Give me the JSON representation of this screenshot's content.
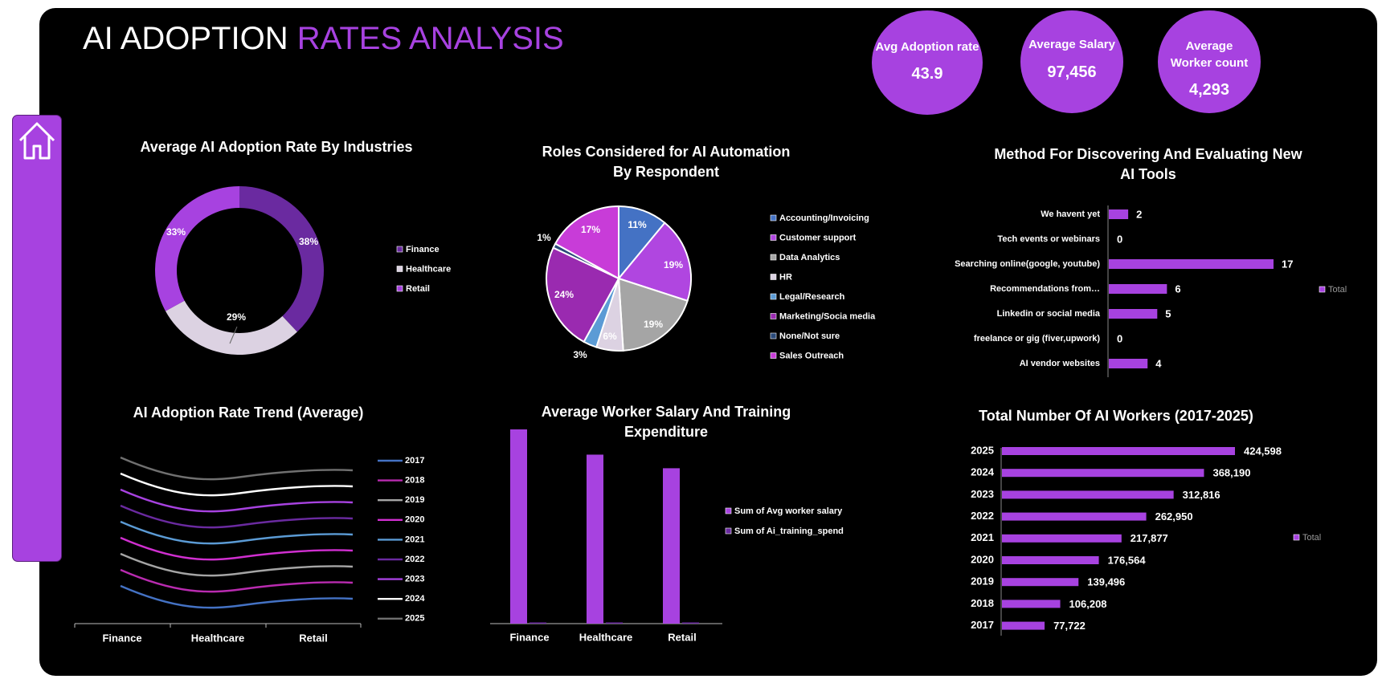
{
  "header": {
    "title_part1": "AI ADOPTION",
    "title_part2": "RATES ANALYSIS"
  },
  "kpis": [
    {
      "label": "Avg Adoption rate",
      "value": "43.9"
    },
    {
      "label": "Average Salary",
      "value": "97,456"
    },
    {
      "label": "Average Worker count",
      "value": "4,293"
    }
  ],
  "icons": {
    "home": "home-icon"
  },
  "colors": {
    "accent": "#a742e0",
    "background": "#000000"
  },
  "chart_data": [
    {
      "id": "industry-donut",
      "type": "pie",
      "title": "Average AI Adoption Rate By Industries",
      "labels": [
        "Finance",
        "Healthcare",
        "Retail"
      ],
      "values": [
        38,
        29,
        33
      ],
      "data_labels": [
        "38%",
        "29%",
        "33%"
      ],
      "colors": [
        "#6a2aa0",
        "#dcd2e2",
        "#a742e0"
      ],
      "legend": "right"
    },
    {
      "id": "roles-pie",
      "type": "pie",
      "title": "Roles Considered for AI Automation By Respondent",
      "labels": [
        "Accounting/Invoicing",
        "Customer support",
        "Data Analytics",
        "HR",
        "Legal/Research",
        "Marketing/Socia media",
        "None/Not sure",
        "Sales Outreach"
      ],
      "values": [
        11,
        19,
        19,
        6,
        3,
        24,
        1,
        17
      ],
      "data_labels": [
        "11%",
        "19%",
        "19%",
        "6%",
        "3%",
        "24%",
        "1%",
        "17%"
      ],
      "colors": [
        "#4472c4",
        "#b046e0",
        "#a5a5a5",
        "#dcd2e2",
        "#5b9bd5",
        "#9a2ab0",
        "#2a4a7a",
        "#c83cd8"
      ],
      "legend": "right"
    },
    {
      "id": "methods-bar",
      "type": "bar",
      "title": "Method For Discovering And Evaluating New AI Tools",
      "categories": [
        "We havent yet",
        "Tech events or webinars",
        "Searching online(google, youtube)",
        "Recommendations from…",
        "Linkedin or social media",
        "freelance or gig (fiver,upwork)",
        "AI vendor websites"
      ],
      "values": [
        2,
        0,
        17,
        6,
        5,
        0,
        4
      ],
      "legend_label": "Total",
      "legend": "right",
      "orientation": "horizontal"
    },
    {
      "id": "trend-lines",
      "type": "line",
      "title": "AI Adoption Rate Trend (Average)",
      "categories": [
        "Finance",
        "Healthcare",
        "Retail"
      ],
      "series": [
        {
          "name": "2017",
          "color": "#4472c4",
          "values": [
            null,
            null,
            null
          ]
        },
        {
          "name": "2018",
          "color": "#b92bb0",
          "values": [
            null,
            null,
            null
          ]
        },
        {
          "name": "2019",
          "color": "#a5a5a5",
          "values": [
            null,
            null,
            null
          ]
        },
        {
          "name": "2020",
          "color": "#d02fd0",
          "values": [
            null,
            null,
            null
          ]
        },
        {
          "name": "2021",
          "color": "#5b9bd5",
          "values": [
            null,
            null,
            null
          ]
        },
        {
          "name": "2022",
          "color": "#6a2aa0",
          "values": [
            null,
            null,
            null
          ]
        },
        {
          "name": "2023",
          "color": "#a742e0",
          "values": [
            null,
            null,
            null
          ]
        },
        {
          "name": "2024",
          "color": "#ffffff",
          "values": [
            null,
            null,
            null
          ]
        },
        {
          "name": "2025",
          "color": "#707070",
          "values": [
            null,
            null,
            null
          ]
        }
      ],
      "legend": "right"
    },
    {
      "id": "salary-bars",
      "type": "bar",
      "title": "Average Worker Salary And Training Expenditure",
      "categories": [
        "Finance",
        "Healthcare",
        "Retail"
      ],
      "series": [
        {
          "name": "Sum of Avg worker salary",
          "color": "#a742e0",
          "values": [
            100,
            87,
            80
          ]
        },
        {
          "name": "Sum of Ai_training_spend",
          "color": "#6a2aa0",
          "values": [
            0.3,
            0.3,
            0.3
          ]
        }
      ],
      "note": "relative heights only; y axis not printed",
      "legend": "right"
    },
    {
      "id": "workers-bar",
      "type": "bar",
      "title": "Total Number Of AI Workers (2017-2025)",
      "categories": [
        "2025",
        "2024",
        "2023",
        "2022",
        "2021",
        "2020",
        "2019",
        "2018",
        "2017"
      ],
      "values": [
        424598,
        368190,
        312816,
        262950,
        217877,
        176564,
        139496,
        106208,
        77722
      ],
      "data_labels": [
        "424,598",
        "368,190",
        "312,816",
        "262,950",
        "217,877",
        "176,564",
        "139,496",
        "106,208",
        "77,722"
      ],
      "legend_label": "Total",
      "legend": "right",
      "orientation": "horizontal"
    }
  ]
}
